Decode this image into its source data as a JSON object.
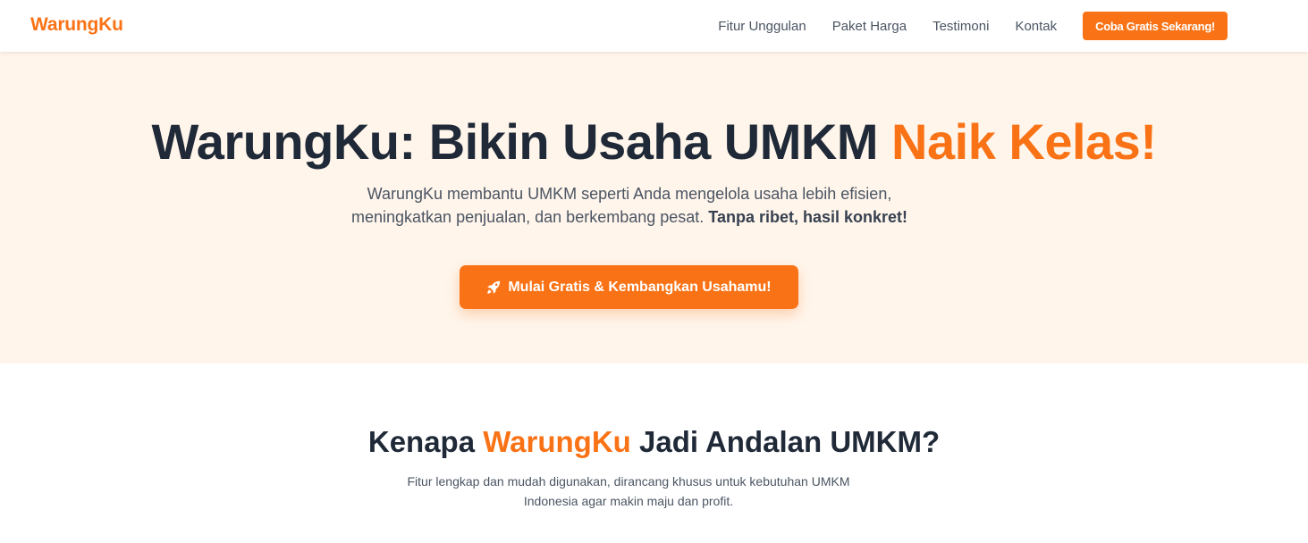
{
  "navbar": {
    "logo": "WarungKu",
    "links": [
      "Fitur Unggulan",
      "Paket Harga",
      "Testimoni",
      "Kontak"
    ],
    "cta_label": "Coba Gratis Sekarang!"
  },
  "hero": {
    "title_main": "WarungKu: Bikin Usaha UMKM ",
    "title_accent": "Naik Kelas!",
    "subtitle_text": "WarungKu membantu UMKM seperti Anda mengelola usaha lebih efisien, meningkatkan penjualan, dan berkembang pesat. ",
    "subtitle_bold": "Tanpa ribet, hasil konkret!",
    "cta_label": "Mulai Gratis & Kembangkan Usahamu!",
    "cta_icon": "rocket-icon"
  },
  "features": {
    "title_pre": "Kenapa ",
    "title_accent": "WarungKu",
    "title_post": " Jadi Andalan UMKM?",
    "subtitle": "Fitur lengkap dan mudah digunakan, dirancang khusus untuk kebutuhan UMKM Indonesia agar makin maju dan profit."
  },
  "colors": {
    "accent": "#f97316",
    "hero_background": "#fff5eb",
    "heading_text": "#1f2937",
    "body_text": "#4b5563"
  }
}
